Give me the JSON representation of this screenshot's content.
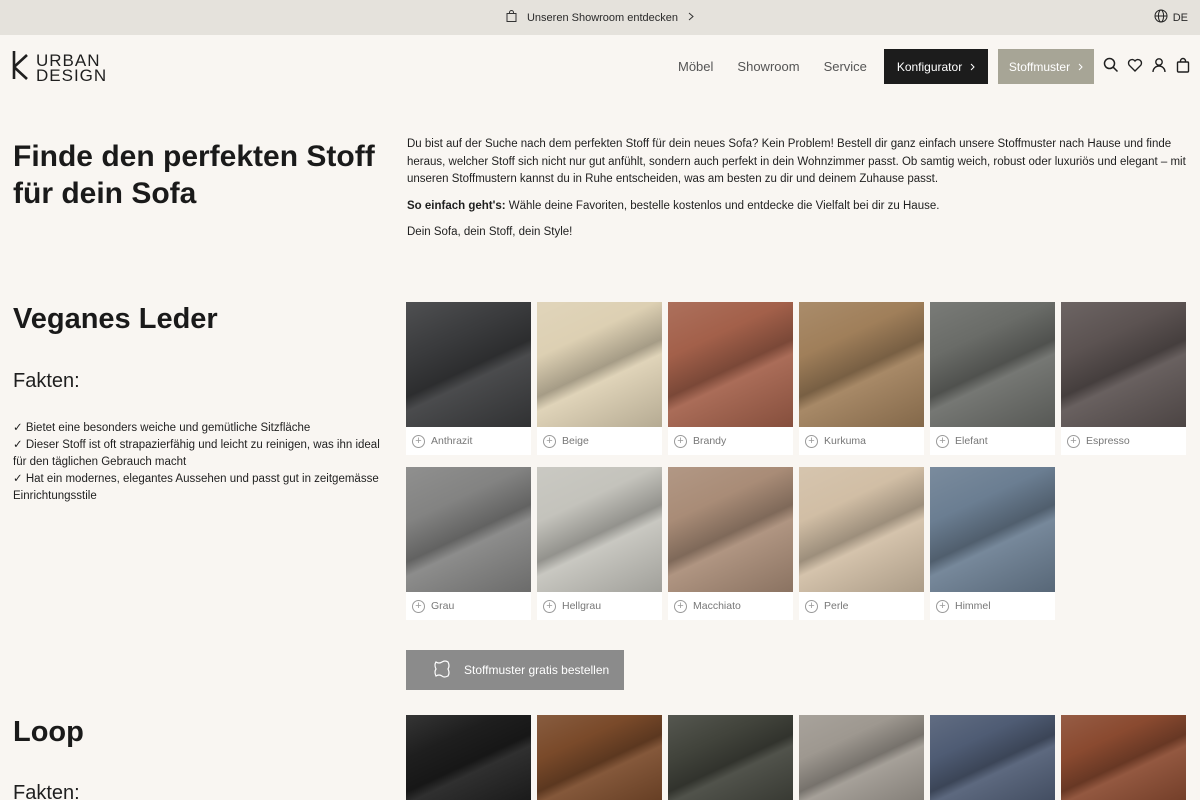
{
  "topbar": {
    "promo_text": "Unseren Showroom entdecken",
    "language": "DE"
  },
  "header": {
    "logo_line1": "URBAN",
    "logo_line2": "DESIGN",
    "nav": [
      "Möbel",
      "Showroom",
      "Service"
    ],
    "konfigurator_label": "Konfigurator",
    "stoffmuster_label": "Stoffmuster"
  },
  "intro": {
    "title": "Finde den perfekten Stoff für dein Sofa",
    "paragraph": "Du bist auf der Suche nach dem perfekten Stoff für dein neues Sofa? Kein Problem! Bestell dir ganz einfach unsere Stoffmuster nach Hause und finde heraus, welcher Stoff sich nicht nur gut anfühlt, sondern auch perfekt in dein Wohnzimmer passt. Ob samtig weich, robust oder luxuriös und elegant – mit unseren Stoffmustern kannst du in Ruhe entscheiden, was am besten zu dir und deinem Zuhause passt.",
    "howto_bold": "So einfach geht's:",
    "howto_text": " Wähle deine Favoriten, bestelle kostenlos und entdecke die Vielfalt bei dir zu Hause.",
    "tagline": "Dein Sofa, dein Stoff, dein Style!"
  },
  "veganes_leder": {
    "title": "Veganes Leder",
    "facts_title": "Fakten:",
    "facts": [
      "✓ Bietet eine besonders weiche und gemütliche Sitzfläche",
      "✓ Dieser Stoff ist oft strapazierfähig und leicht zu reinigen, was ihn ideal für den täglichen Gebrauch macht",
      "✓ Hat ein modernes, elegantes Aussehen und passt gut in zeitgemässe Einrichtungsstile"
    ],
    "swatches": [
      {
        "name": "Anthrazit",
        "color": "#3b3c3e"
      },
      {
        "name": "Beige",
        "color": "#ddd0b3"
      },
      {
        "name": "Brandy",
        "color": "#a3604a"
      },
      {
        "name": "Kurkuma",
        "color": "#a07f5a"
      },
      {
        "name": "Elefant",
        "color": "#6a6c68"
      },
      {
        "name": "Espresso",
        "color": "#5c5352"
      },
      {
        "name": "Grau",
        "color": "#838382"
      },
      {
        "name": "Hellgrau",
        "color": "#c4c3bc"
      },
      {
        "name": "Macchiato",
        "color": "#a98c77"
      },
      {
        "name": "Perle",
        "color": "#d1bea5"
      },
      {
        "name": "Himmel",
        "color": "#6b7e92"
      }
    ],
    "order_button": "Stoffmuster gratis bestellen"
  },
  "loop": {
    "title": "Loop",
    "facts_title": "Fakten:",
    "swatches": [
      {
        "color": "#1e1e1e"
      },
      {
        "color": "#7a4a2a"
      },
      {
        "color": "#42443c"
      },
      {
        "color": "#9e9890"
      },
      {
        "color": "#4f5c74"
      },
      {
        "color": "#8a4a30"
      }
    ]
  }
}
